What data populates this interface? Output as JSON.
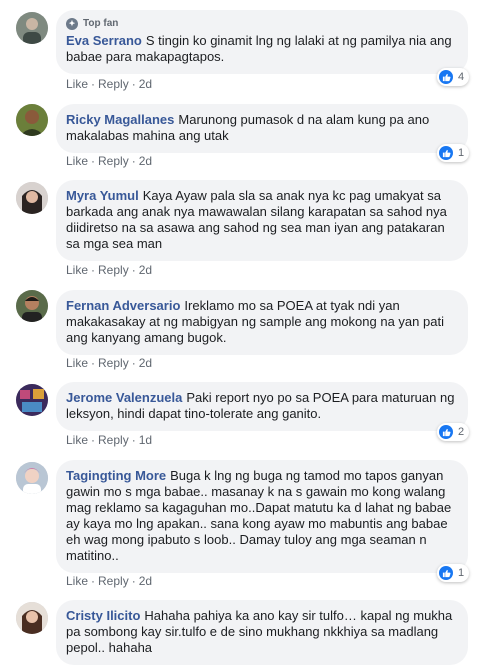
{
  "comments": [
    {
      "badge": "Top fan",
      "name": "Eva Serrano",
      "text": "S tingin ko ginamit lng ng lalaki at ng pamilya nia ang babae para makapagtapos.",
      "like": "Like",
      "reply": "Reply",
      "sep": "·",
      "time": "2d",
      "reactions": "4"
    },
    {
      "name": "Ricky Magallanes",
      "text": "Marunong pumasok d na alam kung pa ano makalabas mahina ang utak",
      "like": "Like",
      "reply": "Reply",
      "sep": "·",
      "time": "2d",
      "reactions": "1"
    },
    {
      "name": "Myra Yumul",
      "text": "Kaya Ayaw pala sla sa anak nya kc pag umakyat sa barkada ang anak nya mawawalan silang karapatan sa sahod nya diidiretso na sa asawa ang sahod ng sea man iyan ang patakaran sa mga sea man",
      "like": "Like",
      "reply": "Reply",
      "sep": "·",
      "time": "2d"
    },
    {
      "name": "Fernan Adversario",
      "text": "Ireklamo mo sa POEA at tyak ndi yan makakasakay at ng mabigyan ng sample ang mokong na yan pati ang kanyang amang bugok.",
      "like": "Like",
      "reply": "Reply",
      "sep": "·",
      "time": "2d"
    },
    {
      "name": "Jerome Valenzuela",
      "text": "Paki report nyo po sa POEA para maturuan ng leksyon, hindi dapat tino-tolerate ang ganito.",
      "like": "Like",
      "reply": "Reply",
      "sep": "·",
      "time": "1d",
      "reactions": "2"
    },
    {
      "name": "Tagingting More",
      "text": "Buga k lng ng buga ng tamod mo tapos ganyan gawin mo s mga babae.. masanay k na s gawain mo kong walang mag reklamo sa kagaguhan mo..Dapat matutu ka d lahat ng babae ay kaya mo lng apakan.. sana kong ayaw mo mabuntis ang babae eh wag mong ipabuto s loob.. Damay tuloy ang mga seaman n matitino..",
      "like": "Like",
      "reply": "Reply",
      "sep": "·",
      "time": "2d",
      "reactions": "1"
    },
    {
      "name": "Cristy Ilicito",
      "text": "Hahaha pahiya ka ano kay sir tulfo… kapal ng mukha pa sombong kay sir.tulfo e de sino mukhang nkkhiya sa madlang pepol.. hahaha"
    }
  ],
  "colors": {
    "name": "#385898",
    "bubble": "#f2f3f5",
    "like_blue": "#1877f2",
    "meta": "#606770"
  },
  "icons": {
    "top_fan": "top-fan-badge-icon",
    "reaction": "like-reaction-icon"
  }
}
